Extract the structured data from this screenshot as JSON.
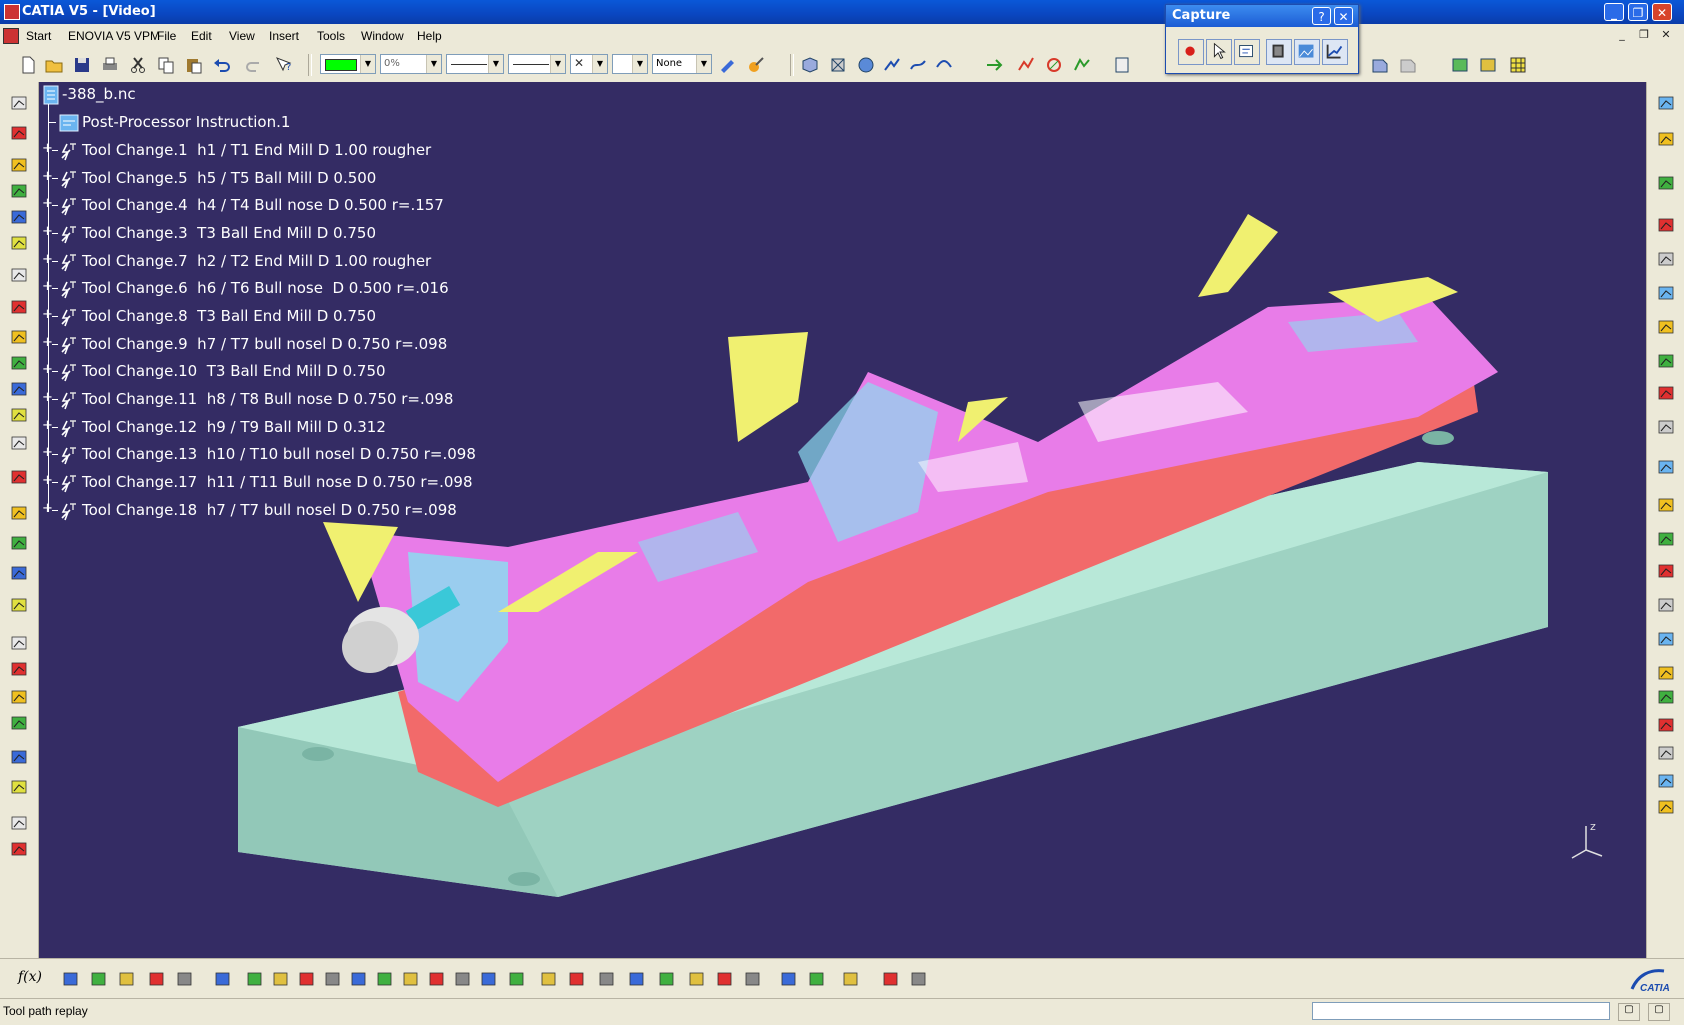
{
  "window": {
    "title": "CATIA V5 - [Video]",
    "buttons": [
      "_",
      "❐",
      "✕"
    ]
  },
  "menu": {
    "items": [
      "Start",
      "ENOVIA V5 VPM",
      "File",
      "Edit",
      "View",
      "Insert",
      "Tools",
      "Window",
      "Help"
    ]
  },
  "toolbar": {
    "color_swatch": "#00ff00",
    "transparency": "0%",
    "layer": "None"
  },
  "capture": {
    "title": "Capture",
    "help": "?",
    "close": "✕"
  },
  "tree": {
    "root": "-388_b.nc",
    "items": [
      "Post-Processor Instruction.1",
      "Tool Change.1  h1 / T1 End Mill D 1.00 rougher",
      "Tool Change.5  h5 / T5 Ball Mill D 0.500",
      "Tool Change.4  h4 / T4 Bull nose D 0.500 r=.157",
      "Tool Change.3  T3 Ball End Mill D 0.750",
      "Tool Change.7  h2 / T2 End Mill D 1.00 rougher",
      "Tool Change.6  h6 / T6 Bull nose  D 0.500 r=.016",
      "Tool Change.8  T3 Ball End Mill D 0.750",
      "Tool Change.9  h7 / T7 bull nosel D 0.750 r=.098",
      "Tool Change.10  T3 Ball End Mill D 0.750",
      "Tool Change.11  h8 / T8 Bull nose D 0.750 r=.098",
      "Tool Change.12  h9 / T9 Ball Mill D 0.312",
      "Tool Change.13  h10 / T10 bull nosel D 0.750 r=.098",
      "Tool Change.17  h11 / T11 Bull nose D 0.750 r=.098",
      "Tool Change.18  h7 / T7 bull nosel D 0.750 r=.098"
    ]
  },
  "axis": {
    "label": "z"
  },
  "status": {
    "text": "Tool path replay"
  },
  "colors": {
    "viewport_bg": "#342c64",
    "stock": "#a8dccc",
    "part_pink": "#e87ce8",
    "part_red": "#f26a6a",
    "part_yellow": "#f0f070",
    "part_cyan": "#8cdcf0"
  },
  "brand": {
    "logo_text": "CATIA"
  }
}
